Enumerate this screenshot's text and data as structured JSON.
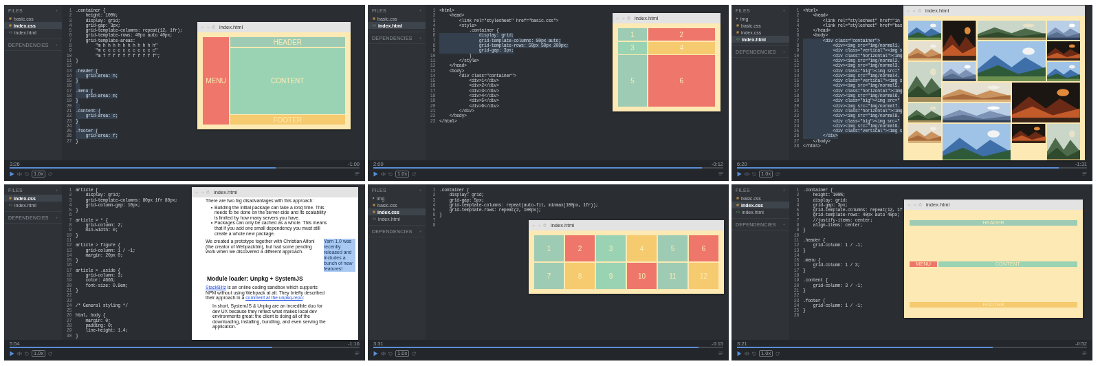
{
  "panels": [
    {
      "files_label": "FILES",
      "dependencies_label": "DEPENDENCIES",
      "files": [
        {
          "name": "basic.css",
          "kind": "css",
          "selected": false
        },
        {
          "name": "index.css",
          "kind": "css",
          "selected": true
        },
        {
          "name": "index.html",
          "kind": "html",
          "selected": false
        }
      ],
      "code": [
        {
          "n": "1",
          "code": ".container {",
          "selected": false
        },
        {
          "n": "2",
          "code": "    height: 100%;",
          "selected": false
        },
        {
          "n": "3",
          "code": "    display: grid;",
          "selected": false
        },
        {
          "n": "4",
          "code": "    grid-gap: 3px;",
          "selected": false
        },
        {
          "n": "5",
          "code": "    grid-template-columns: repeat(12, 1fr);",
          "selected": false
        },
        {
          "n": "6",
          "code": "    grid-template-rows: 40px auto 40px;",
          "selected": false
        },
        {
          "n": "7",
          "code": "    grid-template-areas:",
          "selected": false
        },
        {
          "n": "8",
          "code": "        \"m h h h h h h h h h h h\"",
          "selected": false
        },
        {
          "n": "9",
          "code": "        \"m c c c c c c c c c c c\"",
          "selected": false
        },
        {
          "n": "10",
          "code": "        \"m f f f f f f f f f f f\";",
          "selected": false
        },
        {
          "n": "11",
          "code": "}",
          "selected": false
        },
        {
          "n": "12",
          "selected": false
        },
        {
          "n": "13",
          "code": ".header {",
          "selected": true
        },
        {
          "n": "14",
          "code": "    grid-area: h;",
          "selected": true
        },
        {
          "n": "15",
          "code": "}",
          "selected": true
        },
        {
          "n": "16",
          "selected": true
        },
        {
          "n": "17",
          "code": ".menu {",
          "selected": true
        },
        {
          "n": "18",
          "code": "    grid-area: m;",
          "selected": true
        },
        {
          "n": "19",
          "code": "}",
          "selected": true
        },
        {
          "n": "20",
          "selected": true
        },
        {
          "n": "21",
          "code": ".content {",
          "selected": true
        },
        {
          "n": "22",
          "code": "    grid-area: c;",
          "selected": true
        },
        {
          "n": "23",
          "code": "}",
          "selected": true
        },
        {
          "n": "24",
          "selected": true
        },
        {
          "n": "25",
          "code": ".footer {",
          "selected": true
        },
        {
          "n": "26",
          "code": "    grid-area: f;",
          "selected": true
        },
        {
          "n": "27",
          "code": "}",
          "selected": false
        }
      ],
      "preview": {
        "title": "index.html",
        "kind": "areas",
        "cells": [
          {
            "label": "HEADER",
            "color": "#9ecbb3"
          },
          {
            "label": "MENU",
            "color": "#ee766a"
          },
          {
            "label": "CONTENT",
            "color": "#9ad3b3"
          },
          {
            "label": "FOOTER",
            "color": "#f6ca6e"
          }
        ]
      },
      "player": {
        "elapsed": "3:26",
        "remaining": "-1:00",
        "level": 0.76,
        "speed": "1.0x"
      }
    },
    {
      "files_label": "FILES",
      "dependencies_label": "DEPENDENCIES",
      "files": [
        {
          "name": "basic.css",
          "kind": "css",
          "selected": false
        },
        {
          "name": "index.html",
          "kind": "html",
          "selected": true
        }
      ],
      "code": [
        {
          "n": "1",
          "code": "<html>",
          "selected": false
        },
        {
          "n": "2",
          "code": "    <head>",
          "selected": false
        },
        {
          "n": "3",
          "code": "        <link rel=\"stylesheet\" href=\"basic.css\">",
          "selected": false
        },
        {
          "n": "4",
          "code": "        <style>",
          "selected": false
        },
        {
          "n": "5",
          "code": "            .container {",
          "selected": false
        },
        {
          "n": "6",
          "code": "                display: grid;",
          "selected": true
        },
        {
          "n": "7",
          "code": "                grid-template-columns: 80px auto;",
          "selected": true
        },
        {
          "n": "8",
          "code": "                grid-template-rows: 50px 50px 200px;",
          "selected": true
        },
        {
          "n": "9",
          "code": "                grid-gap: 3px;",
          "selected": true
        },
        {
          "n": "10",
          "code": "            }",
          "selected": false
        },
        {
          "n": "11",
          "code": "        </style>",
          "selected": false
        },
        {
          "n": "12",
          "code": "    </head>",
          "selected": false
        },
        {
          "n": "13",
          "code": "    <body>",
          "selected": false
        },
        {
          "n": "14",
          "code": "        <div class=\"container\">",
          "selected": false
        },
        {
          "n": "15",
          "code": "            <div>1</div>",
          "selected": false
        },
        {
          "n": "16",
          "code": "            <div>2</div>",
          "selected": false
        },
        {
          "n": "17",
          "code": "            <div>3</div>",
          "selected": false
        },
        {
          "n": "18",
          "code": "            <div>4</div>",
          "selected": false
        },
        {
          "n": "19",
          "code": "            <div>5</div>",
          "selected": false
        },
        {
          "n": "20",
          "code": "            <div>6</div>",
          "selected": false
        },
        {
          "n": "21",
          "code": "        </div>",
          "selected": false
        },
        {
          "n": "22",
          "code": "    </body>",
          "selected": false
        },
        {
          "n": "23",
          "code": "</html>",
          "selected": false
        }
      ],
      "preview": {
        "title": "index.html",
        "kind": "track-grid",
        "cells": [
          {
            "label": "1",
            "color": "#9ecbb3"
          },
          {
            "label": "2",
            "color": "#ee766a"
          },
          {
            "label": "3",
            "color": "#9ad3b3"
          },
          {
            "label": "4",
            "color": "#f6ca6e"
          },
          {
            "label": "5",
            "color": "#9ecbb3"
          },
          {
            "label": "6",
            "color": "#ee766a"
          }
        ]
      },
      "player": {
        "elapsed": "2:00",
        "remaining": "-0:12",
        "level": 0.94,
        "speed": "1.0x"
      }
    },
    {
      "files_label": "FILES",
      "dependencies_label": "DEPENDENCIES",
      "files": [
        {
          "name": "img",
          "kind": "folder",
          "selected": false
        },
        {
          "name": "basic.css",
          "kind": "css",
          "selected": false
        },
        {
          "name": "index.css",
          "kind": "css",
          "selected": false
        },
        {
          "name": "index.html",
          "kind": "html",
          "selected": true
        }
      ],
      "code": [
        {
          "n": "1",
          "code": "<html>",
          "selected": false
        },
        {
          "n": "2",
          "code": "    <head>",
          "selected": false
        },
        {
          "n": "3",
          "code": "        <link rel=\"stylesheet\" href=\"in",
          "selected": false
        },
        {
          "n": "4",
          "code": "        <link rel=\"stylesheet\" href=\"bas",
          "selected": false
        },
        {
          "n": "5",
          "code": "    </head>",
          "selected": false
        },
        {
          "n": "6",
          "code": "    <body>",
          "selected": false
        },
        {
          "n": "7",
          "code": "        <div class=\"container\">",
          "selected": true
        },
        {
          "n": "8",
          "code": "            <div><img src=\"img/normal1.",
          "selected": true
        },
        {
          "n": "9",
          "code": "            <div class=\"vertical\"><img s",
          "selected": true
        },
        {
          "n": "10",
          "code": "            <div class=\"horizontal\"><img",
          "selected": true
        },
        {
          "n": "11",
          "code": "            <div><img src=\"img/normal2.",
          "selected": true
        },
        {
          "n": "12",
          "code": "            <div><img src=\"img/normal3.",
          "selected": true
        },
        {
          "n": "13",
          "code": "            <div class=\"big\"><img src=\"",
          "selected": true
        },
        {
          "n": "14",
          "code": "            <div><img src=\"img/normal4.",
          "selected": true
        },
        {
          "n": "15",
          "code": "            <div class=\"vertical\"><img s",
          "selected": true
        },
        {
          "n": "16",
          "code": "            <div><img src=\"img/normal5.",
          "selected": true
        },
        {
          "n": "17",
          "code": "            <div class=\"horizontal\"><img",
          "selected": true
        },
        {
          "n": "18",
          "code": "            <div><img src=\"img/normal6.",
          "selected": true
        },
        {
          "n": "19",
          "code": "            <div class=\"big\"><img src=\"",
          "selected": true
        },
        {
          "n": "20",
          "code": "            <div><img src=\"img/normal7.",
          "selected": true
        },
        {
          "n": "21",
          "code": "            <div class=\"horizontal\"><img",
          "selected": true
        },
        {
          "n": "22",
          "code": "            <div><img src=\"img/normal8.",
          "selected": true
        },
        {
          "n": "23",
          "code": "            <div class=\"big\"><img src=\"",
          "selected": true
        },
        {
          "n": "24",
          "code": "            <div><img src=\"img/normal9.",
          "selected": true
        },
        {
          "n": "25",
          "code": "            <div class=\"vertical\"><img s",
          "selected": true
        },
        {
          "n": "26",
          "code": "        </div>",
          "selected": true
        },
        {
          "n": "27",
          "code": "    </body>",
          "selected": false
        },
        {
          "n": "28",
          "code": "</html>",
          "selected": false
        }
      ],
      "preview": {
        "title": "index.html",
        "kind": "gallery",
        "tiles": [
          {
            "kind": "normal"
          },
          {
            "kind": "vertical"
          },
          {
            "kind": "horizontal"
          },
          {
            "kind": "normal"
          },
          {
            "kind": "normal"
          },
          {
            "kind": "big"
          },
          {
            "kind": "normal"
          },
          {
            "kind": "vertical"
          },
          {
            "kind": "normal"
          },
          {
            "kind": "horizontal"
          },
          {
            "kind": "normal"
          },
          {
            "kind": "big"
          },
          {
            "kind": "normal"
          },
          {
            "kind": "horizontal"
          },
          {
            "kind": "normal"
          },
          {
            "kind": "big"
          },
          {
            "kind": "normal"
          },
          {
            "kind": "vertical"
          }
        ]
      },
      "player": {
        "elapsed": "6:20",
        "remaining": "-1:31",
        "level": 0.92,
        "speed": "1.0x"
      }
    },
    {
      "files_label": "FILES",
      "dependencies_label": "DEPENDENCIES",
      "files": [
        {
          "name": "index.css",
          "kind": "css",
          "selected": true
        },
        {
          "name": "index.html",
          "kind": "html",
          "selected": false
        }
      ],
      "code": [
        {
          "n": "1",
          "code": "article {",
          "selected": false
        },
        {
          "n": "2",
          "code": "    display: grid;",
          "selected": false
        },
        {
          "n": "3",
          "code": "    grid-template-columns: 80px 1fr 80px;",
          "selected": false
        },
        {
          "n": "4",
          "code": "    grid-column-gap: 10px;",
          "selected": false
        },
        {
          "n": "5",
          "code": "}",
          "selected": false
        },
        {
          "n": "6",
          "selected": false
        },
        {
          "n": "7",
          "code": "article > * {",
          "selected": false
        },
        {
          "n": "8",
          "code": "    grid-column: 2;",
          "selected": false
        },
        {
          "n": "9",
          "code": "    min-width: 0;",
          "selected": false
        },
        {
          "n": "10",
          "code": "}",
          "selected": false
        },
        {
          "n": "11",
          "selected": false
        },
        {
          "n": "12",
          "code": "article > figure {",
          "selected": false
        },
        {
          "n": "13",
          "code": "    grid-column: 1 / -1;",
          "selected": false
        },
        {
          "n": "14",
          "code": "    margin: 20px 0;",
          "selected": false
        },
        {
          "n": "15",
          "code": "}",
          "selected": false
        },
        {
          "n": "16",
          "selected": false
        },
        {
          "n": "17",
          "code": "article > .aside {",
          "selected": false
        },
        {
          "n": "18",
          "code": "    grid-column: 3;",
          "selected": false
        },
        {
          "n": "19",
          "code": "    color: #666;",
          "selected": false
        },
        {
          "n": "20",
          "code": "    font-size: 0.8em;",
          "selected": false
        },
        {
          "n": "21",
          "code": "}",
          "selected": false
        },
        {
          "n": "22",
          "selected": false
        },
        {
          "n": "23",
          "selected": false
        },
        {
          "n": "24",
          "code": "/* General styling */",
          "selected": false
        },
        {
          "n": "25",
          "selected": false
        },
        {
          "n": "26",
          "code": "html, body {",
          "selected": false
        },
        {
          "n": "27",
          "code": "    margin: 0;",
          "selected": false
        },
        {
          "n": "28",
          "code": "    padding: 0;",
          "selected": false
        },
        {
          "n": "29",
          "code": "    line-height: 1.4;",
          "selected": false
        },
        {
          "n": "30",
          "code": "}",
          "selected": false
        }
      ],
      "preview": {
        "title": "index.html",
        "kind": "article",
        "article": {
          "intro": "There are two big disadvantages with this approach:",
          "bullets": [
            "Building the initial package can take a *long* time. This needs to be done on the server-side and its scalability is limited by how many servers you have.",
            "Packages can only be cached as a whole. This means that if you add one small dependency you must still create a whole new package."
          ],
          "paragraph": "We created a prototype together with Christian Alfoni (the creator of Webpackbin), but had some pending work when we discovered a different approach.",
          "aside": {
            "text": "Yarn 1.0 was recently released and includes a bunch of new features!",
            "selected": true
          },
          "heading": "Module loader: Unpkg + SystemJS",
          "paragraph_2": [
            {
              "kind": "link",
              "text": "StackBlitz"
            },
            {
              "kind": "text",
              "text": " is an online coding sandbox which supports NPM without using Webpack at all. They briefly described their approach in a "
            },
            {
              "kind": "link",
              "text": "comment at the unpkg-repo"
            },
            {
              "kind": "text",
              "text": ":"
            }
          ],
          "quote": "In short, SystemJS & Unpkg are an incredible duo for dev UX because they reflect what makes local dev environments great: the client is doing all of the downloading, installing, bundling, and even serving the application."
        }
      },
      "player": {
        "elapsed": "5:54",
        "remaining": "-1:16",
        "level": 0.75,
        "speed": "1.0x"
      }
    },
    {
      "files_label": "FILES",
      "dependencies_label": "DEPENDENCIES",
      "files": [
        {
          "name": "img",
          "kind": "folder",
          "selected": false
        },
        {
          "name": "basic.css",
          "kind": "css",
          "selected": false
        },
        {
          "name": "index.css",
          "kind": "css",
          "selected": true
        },
        {
          "name": "index.html",
          "kind": "html",
          "selected": false
        }
      ],
      "code": [
        {
          "n": "1",
          "code": ".container {",
          "selected": false
        },
        {
          "n": "2",
          "code": "    display: grid;",
          "selected": false
        },
        {
          "n": "3",
          "code": "    grid-gap: 5px;",
          "selected": false
        },
        {
          "n": "4",
          "code": "    grid-template-columns: repeat(auto-fit, minmax(100px, 1fr));",
          "selected": false
        },
        {
          "n": "5",
          "code": "    grid-template-rows: repeat(2, 100px);",
          "selected": false
        },
        {
          "n": "6",
          "code": "}",
          "selected": false
        },
        {
          "n": "7",
          "selected": false
        },
        {
          "n": "8",
          "selected": false
        }
      ],
      "preview": {
        "title": "index.html",
        "kind": "even-grid",
        "cells": [
          {
            "label": "1",
            "color": "#9ecbb3"
          },
          {
            "label": "2",
            "color": "#ee766a"
          },
          {
            "label": "3",
            "color": "#9ad3b3"
          },
          {
            "label": "4",
            "color": "#f6ca6e"
          },
          {
            "label": "5",
            "color": "#9ecbb3"
          },
          {
            "label": "6",
            "color": "#ee766a"
          },
          {
            "label": "7",
            "color": "#9ecbb3"
          },
          {
            "label": "8",
            "color": "#f6ca6e"
          },
          {
            "label": "9",
            "color": "#9ad3b3"
          },
          {
            "label": "10",
            "color": "#ee766a"
          },
          {
            "label": "11",
            "color": "#9ecbb3"
          },
          {
            "label": "12",
            "color": "#f6ca6e"
          }
        ]
      },
      "player": {
        "elapsed": "3:31",
        "remaining": "-0:15",
        "level": 0.93,
        "speed": "1.0x"
      }
    },
    {
      "files_label": "FILES",
      "dependencies_label": "DEPENDENCIES",
      "files": [
        {
          "name": "basic.css",
          "kind": "css",
          "selected": false
        },
        {
          "name": "index.css",
          "kind": "css",
          "selected": true
        },
        {
          "name": "index.html",
          "kind": "html",
          "selected": false
        }
      ],
      "code": [
        {
          "n": "1",
          "code": ".container {",
          "selected": false
        },
        {
          "n": "2",
          "code": "    height: 100%;",
          "selected": false
        },
        {
          "n": "3",
          "code": "    display: grid;",
          "selected": false
        },
        {
          "n": "4",
          "code": "    grid-gap: 3px;",
          "selected": false
        },
        {
          "n": "5",
          "code": "    grid-template-columns: repeat(12, 1f",
          "selected": false
        },
        {
          "n": "6",
          "code": "    grid-template-rows: 40px auto 40px;",
          "selected": false
        },
        {
          "n": "7",
          "code": "    //justify-items: center;",
          "selected": false
        },
        {
          "n": "8",
          "code": "    align-items: center;",
          "selected": false
        },
        {
          "n": "9",
          "code": "}",
          "selected": false
        },
        {
          "n": "10",
          "selected": false
        },
        {
          "n": "11",
          "code": ".header {",
          "selected": false
        },
        {
          "n": "12",
          "code": "    grid-column: 1 / -1;",
          "selected": false
        },
        {
          "n": "13",
          "code": "}",
          "selected": false
        },
        {
          "n": "14",
          "selected": false
        },
        {
          "n": "15",
          "code": ".menu {",
          "selected": false
        },
        {
          "n": "16",
          "code": "    grid-column: 1 / 3;",
          "selected": false
        },
        {
          "n": "17",
          "code": "}",
          "selected": false
        },
        {
          "n": "18",
          "selected": false
        },
        {
          "n": "19",
          "code": ".content {",
          "selected": false
        },
        {
          "n": "20",
          "code": "    grid-column: 3 / -1;",
          "selected": false
        },
        {
          "n": "21",
          "code": "}",
          "selected": false
        },
        {
          "n": "22",
          "selected": false
        },
        {
          "n": "23",
          "code": ".footer {",
          "selected": false
        },
        {
          "n": "24",
          "code": "    grid-column: 1 / -1;",
          "selected": false
        },
        {
          "n": "25",
          "code": "}",
          "selected": false
        },
        {
          "n": "26",
          "selected": false
        }
      ],
      "preview": {
        "title": "index.html",
        "kind": "centered-areas",
        "cells": [
          {
            "label": "HEADER",
            "color": "#9ecbb3"
          },
          {
            "label": "MENU",
            "color": "#ee766a"
          },
          {
            "label": "CONTENT",
            "color": "#9ad3b3"
          },
          {
            "label": "FOOTER",
            "color": "#f6ca6e"
          }
        ]
      },
      "player": {
        "elapsed": "3:21",
        "remaining": "-0:52",
        "level": 0.73,
        "speed": "1.0x"
      }
    }
  ]
}
